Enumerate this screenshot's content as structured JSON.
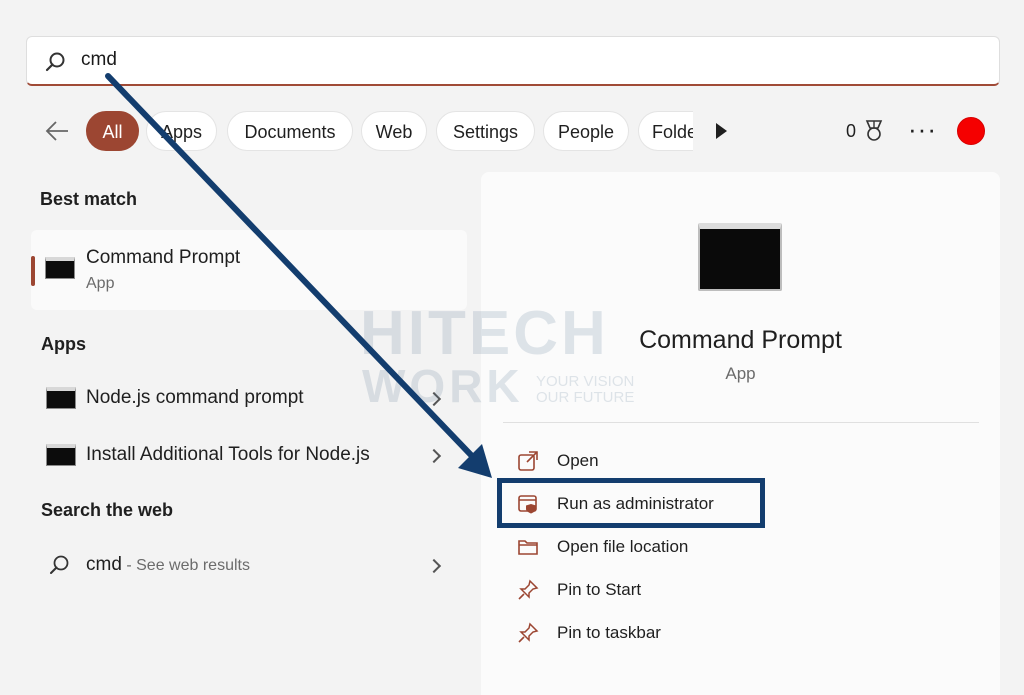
{
  "search": {
    "value": "cmd"
  },
  "filters": [
    "All",
    "Apps",
    "Documents",
    "Web",
    "Settings",
    "People",
    "Folders"
  ],
  "points": "0",
  "best_match": {
    "heading": "Best match",
    "title": "Command Prompt",
    "subtitle": "App"
  },
  "apps": {
    "heading": "Apps",
    "items": [
      "Node.js command prompt",
      "Install Additional Tools for Node.js"
    ]
  },
  "web": {
    "heading": "Search the web",
    "query": "cmd",
    "suffix": " - See web results"
  },
  "detail": {
    "title": "Command Prompt",
    "type": "App",
    "actions": [
      "Open",
      "Run as administrator",
      "Open file location",
      "Pin to Start",
      "Pin to taskbar"
    ]
  },
  "watermark": {
    "line1": "HITECH",
    "line2": "WORK",
    "tagline1": "YOUR VISION",
    "tagline2": "OUR FUTURE"
  },
  "colors": {
    "accent": "#9c4632",
    "annotation": "#133d6e",
    "avatar": "#f50000"
  }
}
